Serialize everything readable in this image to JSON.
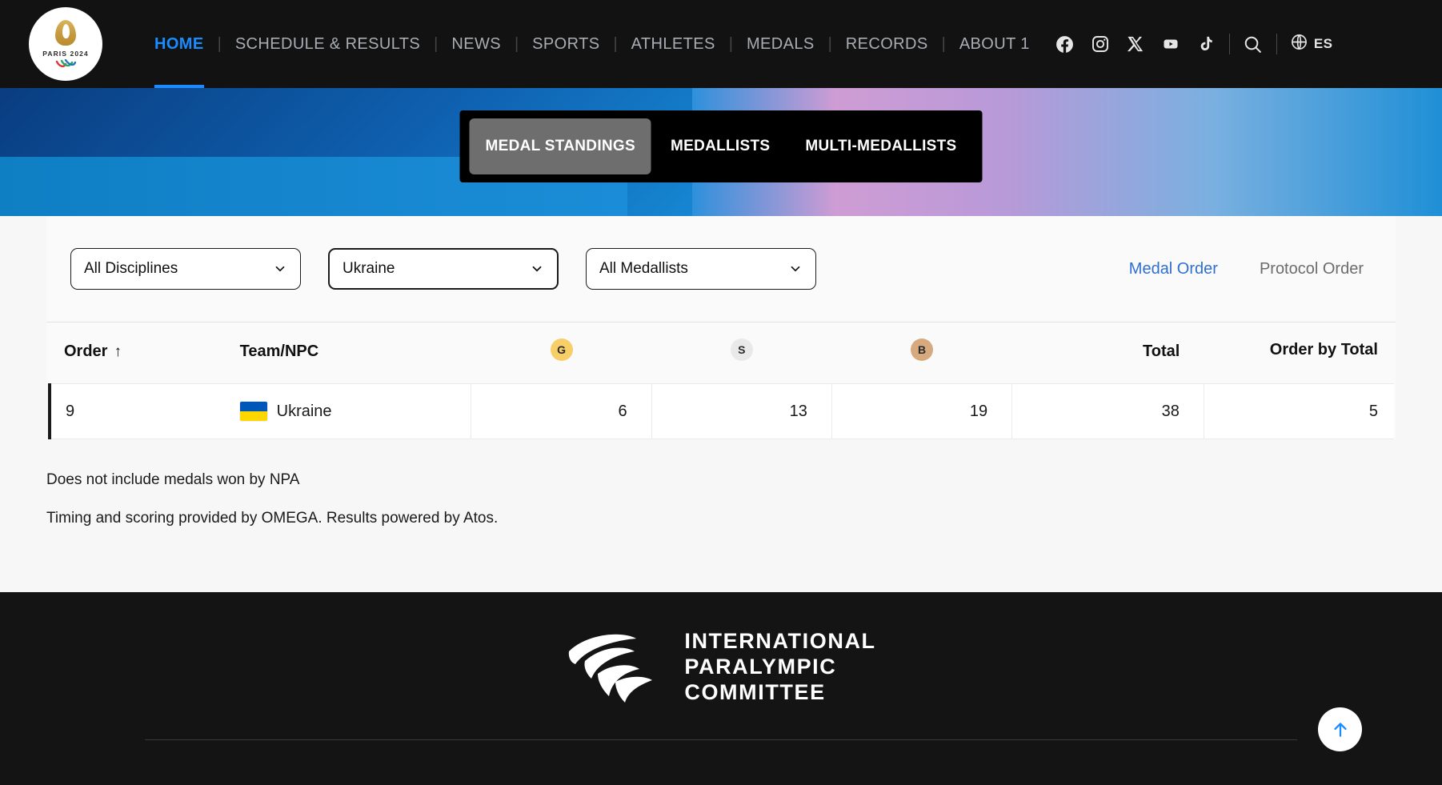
{
  "site": {
    "brand": {
      "logo_text": "PARIS 2024",
      "logo_icon": "paris2024-flame-logo"
    },
    "nav": {
      "items": [
        {
          "label": "HOME",
          "active": true
        },
        {
          "label": "SCHEDULE & RESULTS",
          "active": false
        },
        {
          "label": "NEWS",
          "active": false
        },
        {
          "label": "SPORTS",
          "active": false
        },
        {
          "label": "ATHLETES",
          "active": false
        },
        {
          "label": "MEDALS",
          "active": false
        },
        {
          "label": "RECORDS",
          "active": false
        },
        {
          "label": "ABOUT 1",
          "active": false
        }
      ],
      "social": [
        {
          "name": "facebook-icon"
        },
        {
          "name": "instagram-icon"
        },
        {
          "name": "x-twitter-icon"
        },
        {
          "name": "youtube-icon"
        },
        {
          "name": "tiktok-icon"
        }
      ],
      "search_icon": "search-icon",
      "language": {
        "icon": "globe-icon",
        "label": "ES"
      }
    }
  },
  "hero": {
    "tabs": [
      {
        "label": "MEDAL STANDINGS",
        "active": true
      },
      {
        "label": "MEDALLISTS",
        "active": false
      },
      {
        "label": "MULTI-MEDALLISTS",
        "active": false
      }
    ]
  },
  "filters": {
    "discipline": {
      "value": "All Disciplines"
    },
    "team": {
      "value": "Ukraine"
    },
    "medallists": {
      "value": "All Medallists"
    },
    "order_links": [
      {
        "label": "Medal Order",
        "active": true
      },
      {
        "label": "Protocol Order",
        "active": false
      }
    ]
  },
  "table": {
    "headers": {
      "order": "Order",
      "sort_arrow": "↑",
      "team": "Team/NPC",
      "gold": "G",
      "silver": "S",
      "bronze": "B",
      "total": "Total",
      "order_by_total": "Order by Total"
    },
    "rows": [
      {
        "order": "9",
        "team": "Ukraine",
        "flag": "ukraine-flag",
        "gold": "6",
        "silver": "13",
        "bronze": "19",
        "total": "38",
        "order_by_total": "5"
      }
    ]
  },
  "notes": [
    "Does not include medals won by NPA",
    "Timing and scoring provided by OMEGA. Results powered by Atos."
  ],
  "footer": {
    "logo_line1": "INTERNATIONAL",
    "logo_line2": "PARALYMPIC",
    "logo_line3": "COMMITTEE",
    "logo_icon": "agitos-logo",
    "back_to_top_icon": "arrow-up-icon"
  },
  "colors": {
    "accent_blue": "#1a8cff",
    "link_blue": "#2f6fd0",
    "gold": "#f7ce68",
    "silver": "#e9e9e9",
    "bronze": "#d6a97e",
    "nav_bg": "#121212"
  }
}
